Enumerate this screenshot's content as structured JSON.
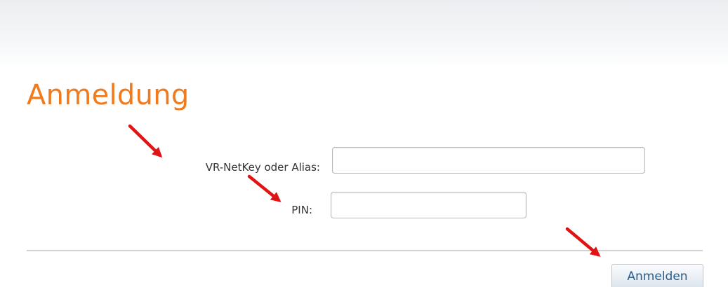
{
  "page": {
    "title": "Anmeldung"
  },
  "form": {
    "netkey_label": "VR-NetKey oder Alias:",
    "netkey_value": "",
    "pin_label": "PIN:",
    "pin_value": "",
    "submit_label": "Anmelden"
  },
  "colors": {
    "title": "#f07b1f",
    "annotation_arrow": "#e01414",
    "button_text": "#2a5d8c"
  }
}
